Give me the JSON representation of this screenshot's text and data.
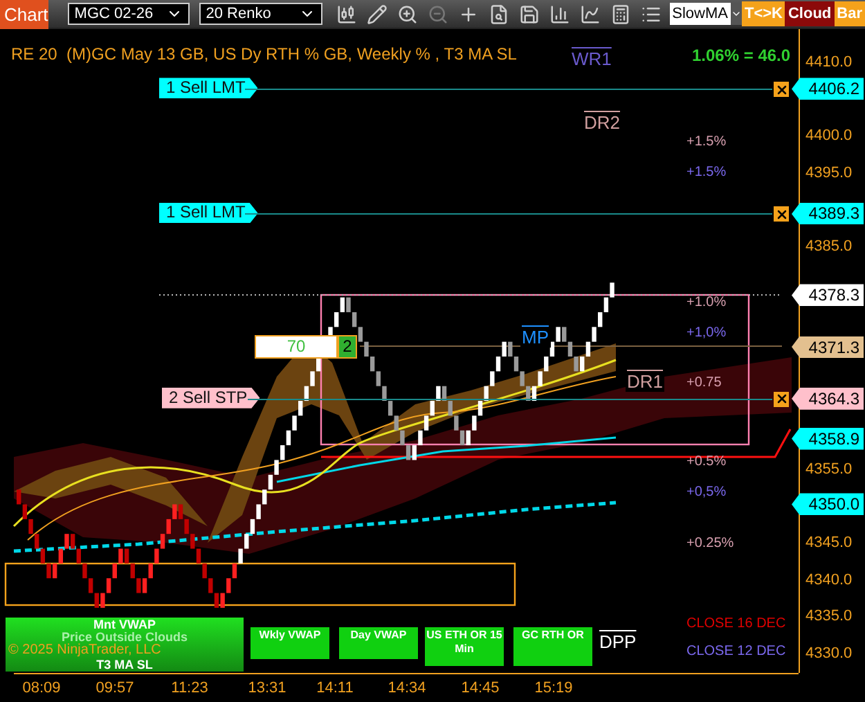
{
  "toolbar": {
    "title": "Chart",
    "instrument": "MGC 02-26",
    "bar_type": "20 Renko",
    "indicator": "SlowMA",
    "buttons": [
      {
        "label": "T<>K",
        "color": "#f5a21b"
      },
      {
        "label": "Cloud",
        "color": "#8c0a0a"
      },
      {
        "label": "Bar",
        "color": "#f5a21b"
      }
    ]
  },
  "chart": {
    "header": "RE 20  (M)GC May 13 GB, US Dy RTH % GB, Weekly % , T3 MA SL",
    "change_readout": "1.06% = 46.0",
    "order_lines": [
      {
        "label": "1 Sell LMT",
        "color": "#00ffff"
      },
      {
        "label": "1 Sell LMT",
        "color": "#00ffff"
      },
      {
        "label": "2 Sell STP",
        "color": "#ffc0cb"
      }
    ],
    "position": {
      "price": "70",
      "quantity": "2"
    },
    "level_labels": [
      {
        "label": "WR1",
        "color": "#6a5acd"
      },
      {
        "label": "DR2",
        "color": "#d2a0a0"
      },
      {
        "label": "MP",
        "color": "#1e90ff"
      },
      {
        "label": "DR1",
        "color": "#d2a0a0"
      },
      {
        "label": "DPP",
        "color": "#ffffff"
      }
    ],
    "percent_labels": [
      {
        "label": "+1.5%",
        "color": "#d8a0b0"
      },
      {
        "label": "+1.5%",
        "color": "#7b68ee"
      },
      {
        "label": "+1.0%",
        "color": "#d8a0b0"
      },
      {
        "label": "+1,0%",
        "color": "#7b68ee"
      },
      {
        "label": "+0.75",
        "color": "#d8a0b0"
      },
      {
        "label": "+0.5%",
        "color": "#d8a0b0"
      },
      {
        "label": "+0,5%",
        "color": "#7b68ee"
      },
      {
        "label": "+0.25%",
        "color": "#d8a0b0"
      }
    ],
    "close_labels": [
      {
        "label": "CLOSE 16 DEC",
        "color": "#e00000"
      },
      {
        "label": "CLOSE 12 DEC",
        "color": "#7b68ee"
      }
    ],
    "monthly_panel": {
      "title": "Mnt VWAP",
      "status": "Price Outside Clouds",
      "indicator": "T3 MA SL"
    },
    "copyright": "© 2025 NinjaTrader, LLC",
    "indicator_panels": [
      "Wkly VWAP",
      "Day VWAP",
      "US ETH OR 15 Min",
      "GC RTH OR"
    ]
  },
  "price_axis": {
    "ticks": [
      "4410.0",
      "4400.0",
      "4395.0",
      "4385.0",
      "4355.0",
      "4345.0",
      "4340.0",
      "4335.0",
      "4330.0"
    ],
    "markers": [
      {
        "price": "4406.2",
        "color": "#00ffff"
      },
      {
        "price": "4389.3",
        "color": "#00ffff"
      },
      {
        "price": "4378.3",
        "color": "#ffffff"
      },
      {
        "price": "4371.3",
        "color": "#e3c08f"
      },
      {
        "price": "4364.3",
        "color": "#ffc0cb"
      },
      {
        "price": "4358.9",
        "color": "#00ffff"
      },
      {
        "price": "4350.0",
        "color": "#00ffff"
      }
    ]
  },
  "time_axis": {
    "ticks": [
      "08:09",
      "09:57",
      "11:23",
      "13:31",
      "14:11",
      "14:34",
      "14:45",
      "15:19"
    ]
  }
}
